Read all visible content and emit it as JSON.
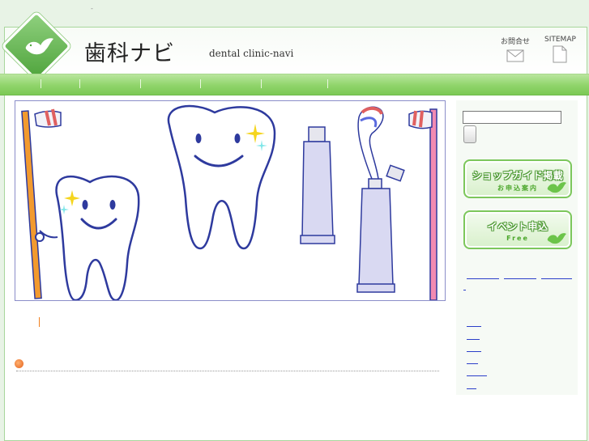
{
  "header": {
    "site_title": "歯科ナビ",
    "site_subtitle": "dental clinic-navi",
    "links": [
      {
        "label": "お問合せ",
        "icon": "envelope-icon"
      },
      {
        "label": "SITEMAP",
        "icon": "document-icon"
      }
    ]
  },
  "top_marker": "-",
  "sidebar": {
    "banners": [
      {
        "main": "ショップガイド掲載",
        "sub": "お申込案内"
      },
      {
        "main": "イベント申込",
        "sub": "Free"
      }
    ]
  },
  "colors": {
    "accent_green": "#7cc955",
    "page_bg": "#e8f3e6",
    "link_blue": "#2b3fc9",
    "border": "#a8d69c"
  }
}
